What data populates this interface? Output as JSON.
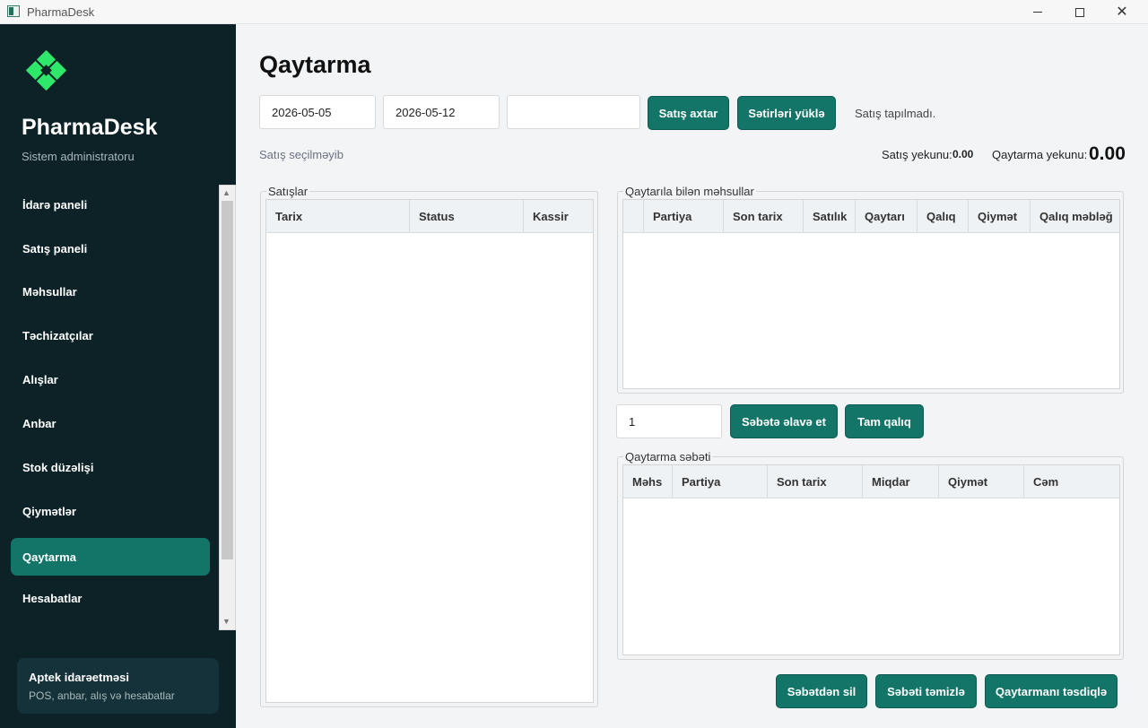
{
  "window": {
    "title": "PharmaDesk"
  },
  "sidebar": {
    "brand": "PharmaDesk",
    "role": "Sistem administratoru",
    "items": [
      {
        "label": "İdarə paneli"
      },
      {
        "label": "Satış paneli"
      },
      {
        "label": "Məhsullar"
      },
      {
        "label": "Təchizatçılar"
      },
      {
        "label": "Alışlar"
      },
      {
        "label": "Anbar"
      },
      {
        "label": "Stok düzəlişi"
      },
      {
        "label": "Qiymətlər"
      },
      {
        "label": "Qaytarma"
      },
      {
        "label": "Hesabatlar"
      }
    ],
    "active_item": "Qaytarma",
    "footer": {
      "title": "Aptek idarəetməsi",
      "subtitle": "POS, anbar, alış və hesabatlar"
    }
  },
  "main": {
    "title": "Qaytarma",
    "filters": {
      "date_from": "2026-05-05",
      "date_to": "2026-05-12",
      "search": ""
    },
    "buttons": {
      "search_sales": "Satış axtar",
      "load_rows": "Sətirləri yüklə"
    },
    "status": "Satış tapılmadı.",
    "selection_status": "Satış seçilməyib",
    "totals": {
      "sale_label": "Satış yekunu:",
      "sale_value": "0.00",
      "return_label": "Qaytarma yekunu:",
      "return_value": "0.00"
    },
    "sales_group": {
      "title": "Satışlar",
      "columns": [
        "Tarix",
        "Status",
        "Kassir"
      ]
    },
    "returnable_group": {
      "title": "Qaytarıla bilən məhsullar",
      "columns": [
        "Partiya",
        "Son tarix",
        "Satılık",
        "Qaytarı",
        "Qalıq",
        "Qiymət",
        "Qalıq məbləğ"
      ]
    },
    "quantity": "1",
    "cart_buttons": {
      "add_to_cart": "Səbətə əlavə et",
      "full_remaining": "Tam qalıq"
    },
    "cart_group": {
      "title": "Qaytarma səbəti",
      "columns": [
        "Məhs",
        "Partiya",
        "Son tarix",
        "Miqdar",
        "Qiymət",
        "Cəm"
      ]
    },
    "bottom_buttons": {
      "remove_from_cart": "Səbətdən sil",
      "clear_cart": "Səbəti təmizlə",
      "confirm_return": "Qaytarmanı təsdiqlə"
    }
  },
  "colors": {
    "accent": "#137568",
    "sidebar_bg": "#0c2227",
    "logo_green": "#2ee86a"
  }
}
